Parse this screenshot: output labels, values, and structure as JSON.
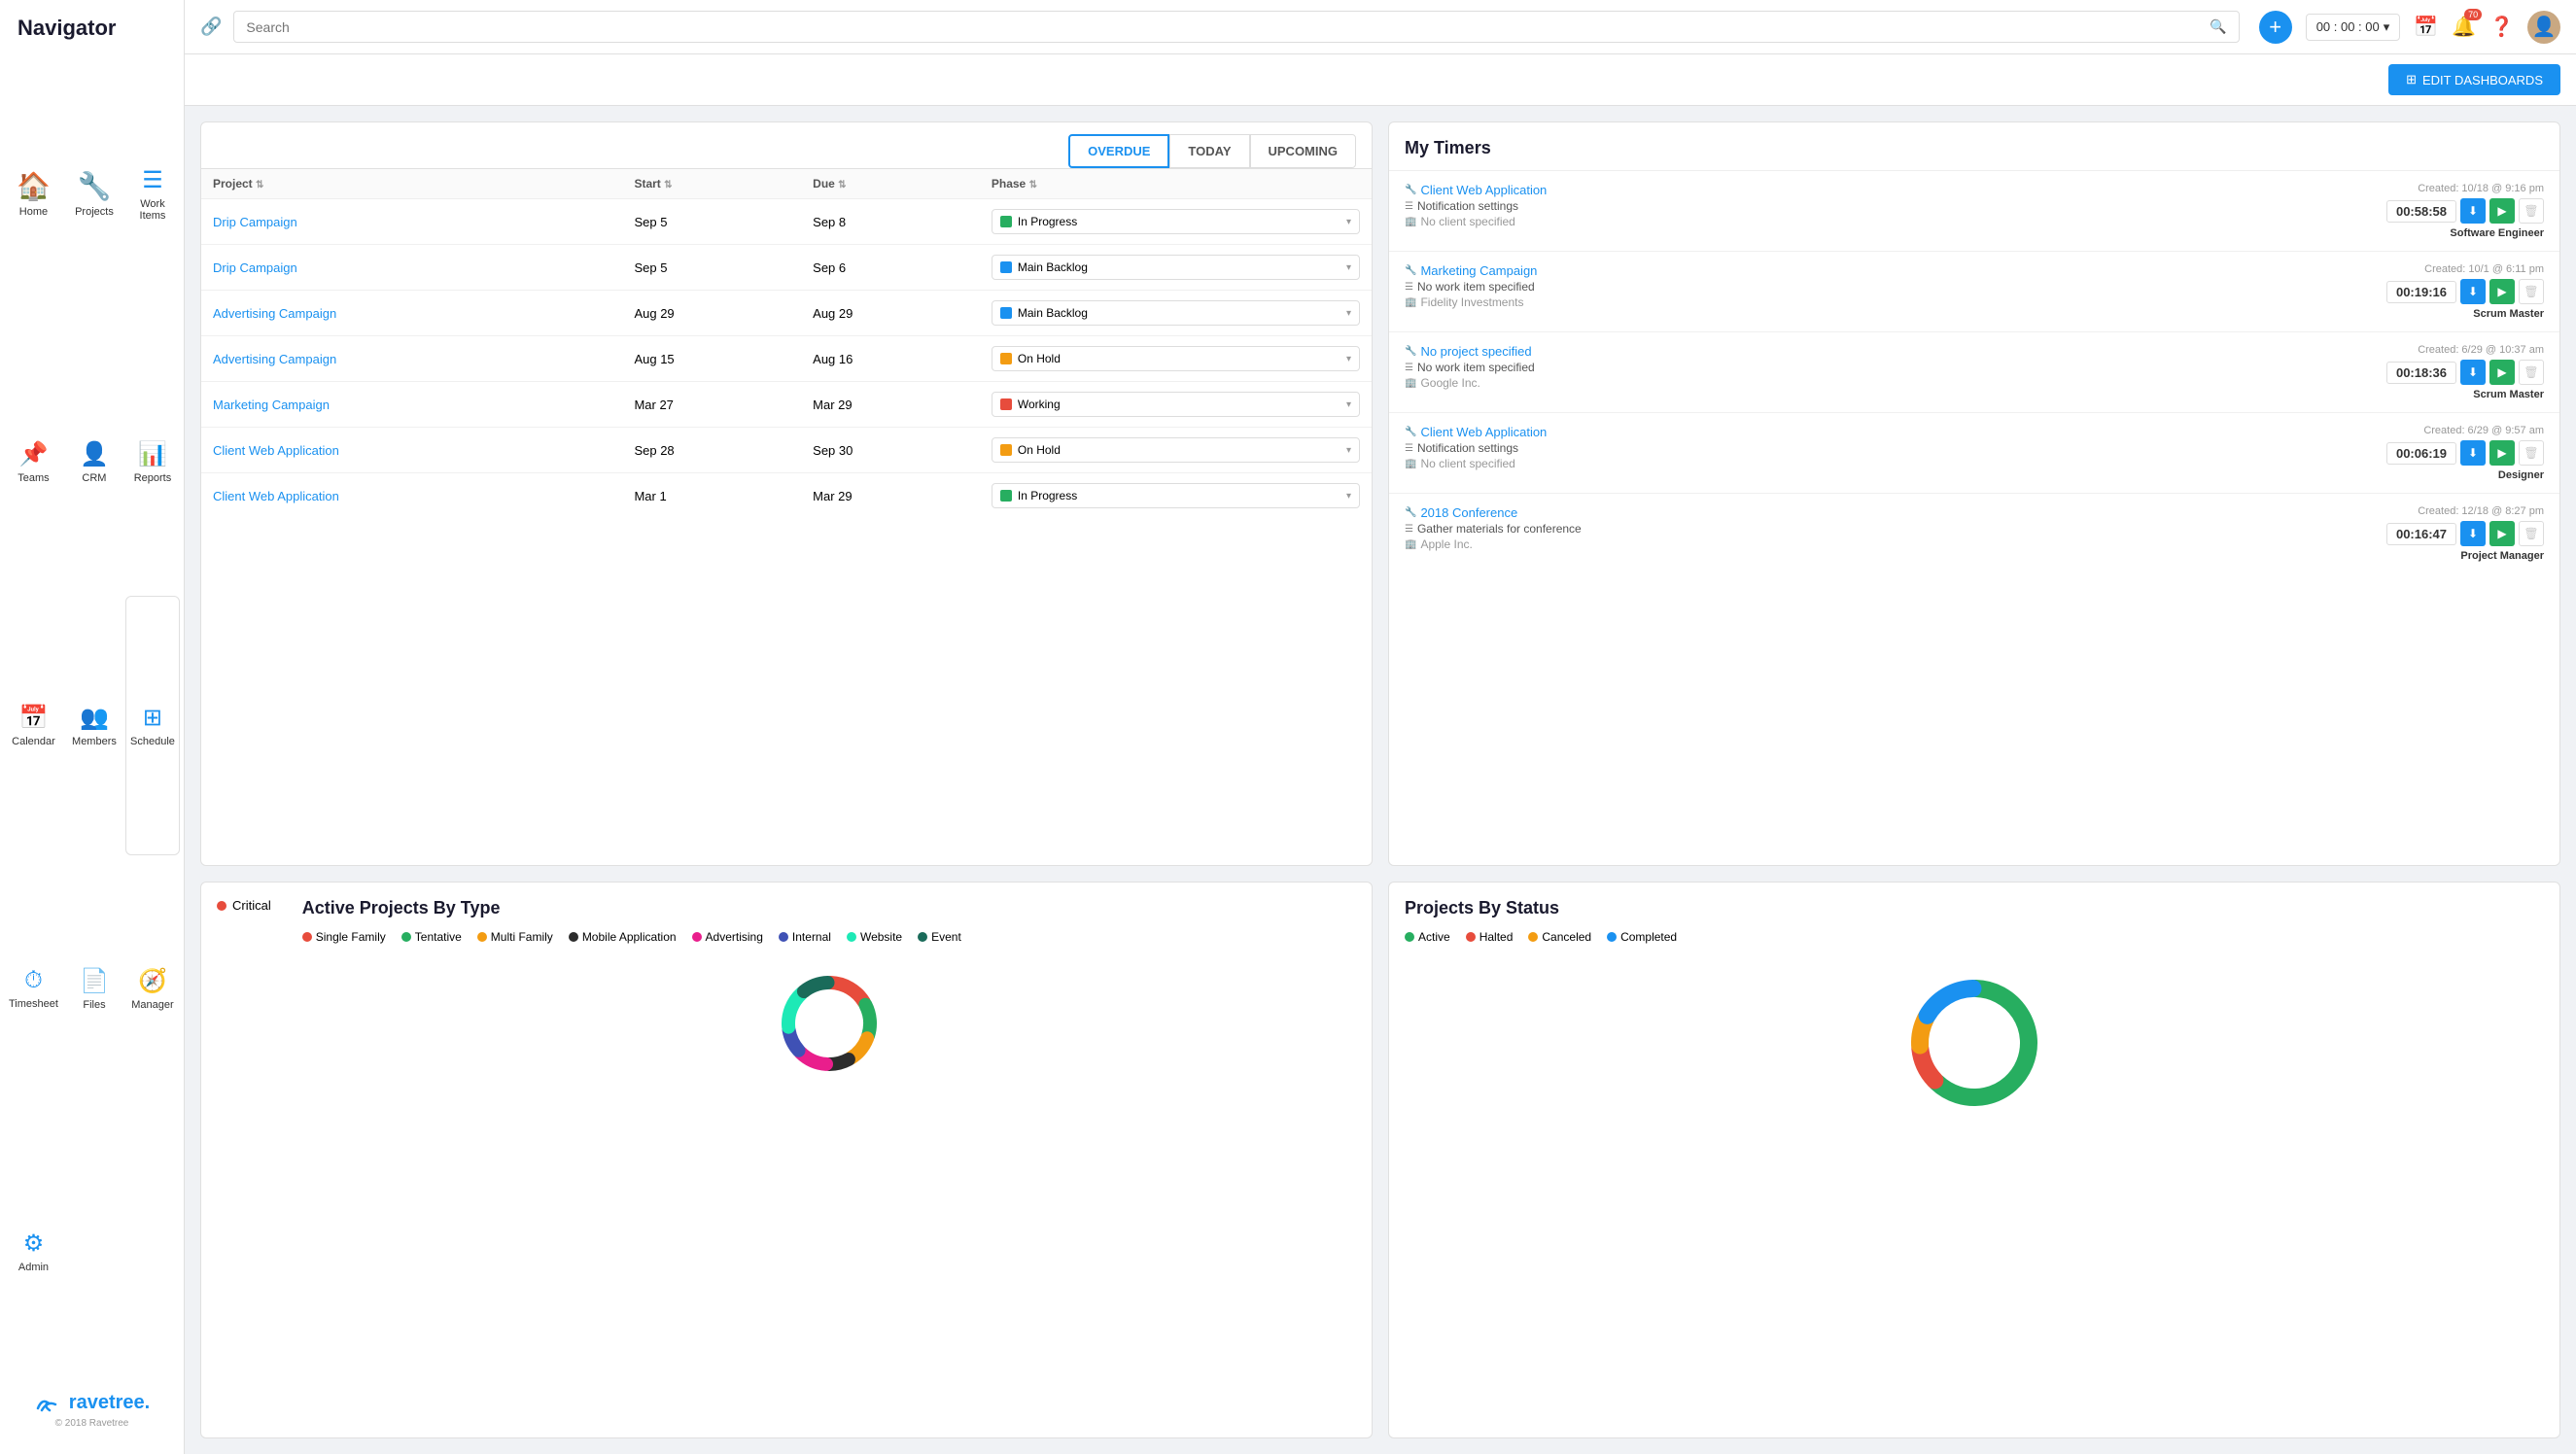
{
  "sidebar": {
    "title": "Navigator",
    "items": [
      {
        "id": "home",
        "label": "Home",
        "icon": "🏠"
      },
      {
        "id": "projects",
        "label": "Projects",
        "icon": "🔧"
      },
      {
        "id": "work-items",
        "label": "Work Items",
        "icon": "☰"
      },
      {
        "id": "teams",
        "label": "Teams",
        "icon": "📌"
      },
      {
        "id": "crm",
        "label": "CRM",
        "icon": "👤"
      },
      {
        "id": "reports",
        "label": "Reports",
        "icon": "📊"
      },
      {
        "id": "calendar",
        "label": "Calendar",
        "icon": "📅"
      },
      {
        "id": "members",
        "label": "Members",
        "icon": "👥"
      },
      {
        "id": "schedule",
        "label": "Schedule",
        "icon": "⊞"
      },
      {
        "id": "timesheet",
        "label": "Timesheet",
        "icon": "⏱"
      },
      {
        "id": "files",
        "label": "Files",
        "icon": "📄"
      },
      {
        "id": "manager",
        "label": "Manager",
        "icon": "🧭"
      },
      {
        "id": "admin",
        "label": "Admin",
        "icon": "⚙"
      }
    ],
    "footer": {
      "logo": "ravetree.",
      "copyright": "© 2018 Ravetree"
    }
  },
  "header": {
    "search_placeholder": "Search",
    "timer": "00 : 00 : 00",
    "notification_count": "70",
    "edit_dashboards": "EDIT DASHBOARDS"
  },
  "tabs": {
    "overdue": "OVERDUE",
    "today": "TODAY",
    "upcoming": "UPCOMING"
  },
  "table": {
    "columns": [
      "Project",
      "Start",
      "Due",
      "Phase"
    ],
    "rows": [
      {
        "project": "Drip Campaign",
        "start": "Sep 5",
        "due": "Sep 8",
        "phase": "In Progress",
        "phase_color": "#27ae60"
      },
      {
        "project": "Drip Campaign",
        "start": "Sep 5",
        "due": "Sep 6",
        "phase": "Main Backlog",
        "phase_color": "#1a91f0"
      },
      {
        "project": "Advertising Campaign",
        "start": "Aug 29",
        "due": "Aug 29",
        "phase": "Main Backlog",
        "phase_color": "#1a91f0"
      },
      {
        "project": "Advertising Campaign",
        "start": "Aug 15",
        "due": "Aug 16",
        "phase": "On Hold",
        "phase_color": "#f39c12"
      },
      {
        "project": "Marketing Campaign",
        "start": "Mar 27",
        "due": "Mar 29",
        "phase": "Working",
        "phase_color": "#e74c3c"
      },
      {
        "project": "Client Web Application",
        "start": "Sep 28",
        "due": "Sep 30",
        "phase": "On Hold",
        "phase_color": "#f39c12"
      },
      {
        "project": "Client Web Application",
        "start": "Mar 1",
        "due": "Mar 29",
        "phase": "In Progress",
        "phase_color": "#27ae60"
      }
    ]
  },
  "timers": {
    "title": "My Timers",
    "entries": [
      {
        "project": "Client Web Application",
        "workitem": "Notification settings",
        "client": "No client specified",
        "created": "Created: 10/18 @ 9:16 pm",
        "time": "00:58:58",
        "role": "Software Engineer"
      },
      {
        "project": "Marketing Campaign",
        "workitem": "No work item specified",
        "client": "Fidelity Investments",
        "created": "Created: 10/1 @ 6:11 pm",
        "time": "00:19:16",
        "role": "Scrum Master"
      },
      {
        "project": "No project specified",
        "workitem": "No work item specified",
        "client": "Google Inc.",
        "created": "Created: 6/29 @ 10:37 am",
        "time": "00:18:36",
        "role": "Scrum Master"
      },
      {
        "project": "Client Web Application",
        "workitem": "Notification settings",
        "client": "No client specified",
        "created": "Created: 6/29 @ 9:57 am",
        "time": "00:06:19",
        "role": "Designer"
      },
      {
        "project": "2018 Conference",
        "workitem": "Gather materials for conference",
        "client": "Apple Inc.",
        "created": "Created: 12/18 @ 8:27 pm",
        "time": "00:16:47",
        "role": "Project Manager"
      }
    ]
  },
  "active_projects": {
    "title": "Active Projects By Type",
    "legend": [
      {
        "label": "Single Family",
        "color": "#e74c3c"
      },
      {
        "label": "Tentative",
        "color": "#27ae60"
      },
      {
        "label": "Multi Family",
        "color": "#f39c12"
      },
      {
        "label": "Mobile Application",
        "color": "#2c2c2c"
      },
      {
        "label": "Advertising",
        "color": "#e91e8c"
      },
      {
        "label": "Internal",
        "color": "#3f51b5"
      },
      {
        "label": "Website",
        "color": "#1de9b6"
      },
      {
        "label": "Event",
        "color": "#1a6b5a"
      }
    ],
    "critical_label": "Critical",
    "donut_segments": [
      {
        "color": "#e74c3c",
        "value": 15
      },
      {
        "color": "#27ae60",
        "value": 12
      },
      {
        "color": "#f39c12",
        "value": 10
      },
      {
        "color": "#2c2c2c",
        "value": 8
      },
      {
        "color": "#e91e8c",
        "value": 11
      },
      {
        "color": "#3f51b5",
        "value": 9
      },
      {
        "color": "#1de9b6",
        "value": 14
      },
      {
        "color": "#1a6b5a",
        "value": 10
      }
    ]
  },
  "projects_by_status": {
    "title": "Projects By Status",
    "legend": [
      {
        "label": "Active",
        "color": "#27ae60"
      },
      {
        "label": "Halted",
        "color": "#e74c3c"
      },
      {
        "label": "Canceled",
        "color": "#f39c12"
      },
      {
        "label": "Completed",
        "color": "#1a91f0"
      }
    ],
    "donut_segments": [
      {
        "color": "#27ae60",
        "value": 55
      },
      {
        "color": "#e74c3c",
        "value": 10
      },
      {
        "color": "#f39c12",
        "value": 8
      },
      {
        "color": "#1a91f0",
        "value": 15
      }
    ]
  }
}
